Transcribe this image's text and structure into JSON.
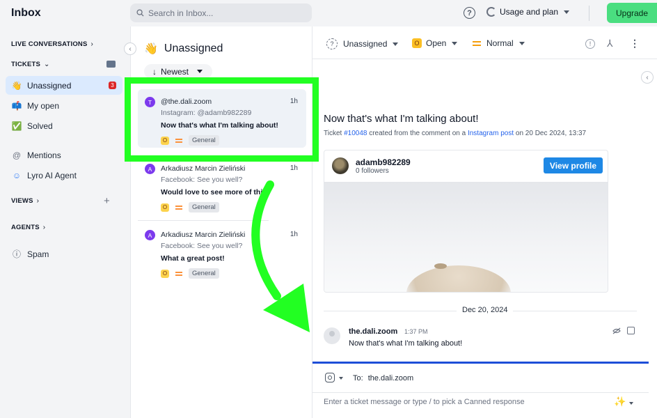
{
  "app": {
    "title": "Inbox"
  },
  "search": {
    "placeholder": "Search in Inbox..."
  },
  "topbar": {
    "usage_label": "Usage and plan",
    "upgrade_label": "Upgrade"
  },
  "sidebar": {
    "live_conversations": "LIVE CONVERSATIONS",
    "tickets": "TICKETS",
    "items": [
      {
        "label": "Unassigned",
        "icon": "👋",
        "badge": "3"
      },
      {
        "label": "My open",
        "icon": "📫"
      },
      {
        "label": "Solved",
        "icon": "✅"
      }
    ],
    "mentions": "Mentions",
    "lyro": "Lyro AI Agent",
    "views": "VIEWS",
    "agents": "AGENTS",
    "spam": "Spam"
  },
  "list": {
    "title": "Unassigned",
    "title_icon": "👋",
    "sort_label": "Newest",
    "cards": [
      {
        "avatar": "T",
        "name": "@the.dali.zoom",
        "time": "1h",
        "source": "Instagram: @adamb982289",
        "message": "Now that's what I'm talking about!",
        "status": "O",
        "tag": "General"
      },
      {
        "avatar": "A",
        "name": "Arkadiusz Marcin Zieliński",
        "time": "1h",
        "source": "Facebook: See you well?",
        "message": "Would love to see more of this",
        "status": "O",
        "tag": "General"
      },
      {
        "avatar": "A",
        "name": "Arkadiusz Marcin Zieliński",
        "time": "1h",
        "source": "Facebook: See you well?",
        "message": "What a great post!",
        "status": "O",
        "tag": "General"
      }
    ]
  },
  "toolbar": {
    "assignee": "Unassigned",
    "status": "Open",
    "status_letter": "O",
    "priority": "Normal"
  },
  "ticket": {
    "title": "Now that's what I'm talking about!",
    "meta_prefix": "Ticket ",
    "ticket_id": "#10048",
    "meta_middle": " created from the comment on a ",
    "post_link": "Instagram post",
    "meta_suffix": " on 20 Dec 2024, 13:37"
  },
  "post": {
    "username": "adamb982289",
    "followers": "0 followers",
    "view_profile": "View profile"
  },
  "conversation": {
    "date": "Dec 20, 2024",
    "messages": [
      {
        "author": "the.dali.zoom",
        "time": "1:37 PM",
        "text": "Now that's what I'm talking about!"
      }
    ]
  },
  "composer": {
    "to_label": "To:",
    "to_value": "the.dali.zoom",
    "placeholder": "Enter a ticket message or type / to pick a Canned response"
  },
  "colors": {
    "highlight": "#22ff22",
    "upgrade": "#4ade80",
    "accent_blue": "#1d4ed8"
  }
}
